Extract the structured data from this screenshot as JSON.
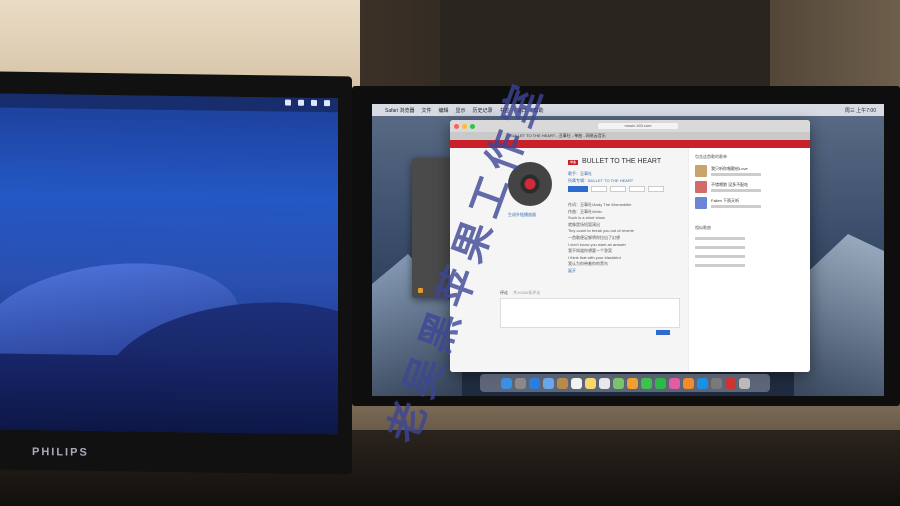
{
  "left_monitor": {
    "brand": "PHILIPS"
  },
  "right_monitor": {
    "menubar": {
      "apple": "",
      "items": [
        "Safari 浏览器",
        "文件",
        "编辑",
        "显示",
        "历史记录",
        "书签",
        "窗口",
        "帮助"
      ],
      "clock": "周三 上午7:00"
    },
    "safari": {
      "url": "music.163.com",
      "tabs": [
        "BULLET TO THE HEART - 丑事社 - 单曲 - 网易云音乐"
      ],
      "song_title": "BULLET TO THE HEART",
      "tag": "单曲",
      "meta": [
        "歌手：丑事社",
        "所属专辑：BULLET TO THE HEART"
      ],
      "buttons": [
        "播放",
        "收藏",
        "分享",
        "下载",
        "评论"
      ],
      "disc_label": "生成外链播放器",
      "lyrics": [
        "作词：丑事社/Andy The Wornedelle",
        "作曲：丑事社/Ieblo",
        "Such is a short show",
        "就像是场短暂演出",
        "Tiny count to break you out of reverie",
        "一首歌便足够将你拉出了幻想",
        "I don't know you want an answer",
        "我不知道你想要一个答案",
        "I think that with your blackbird",
        "我认为你带着你的黑鸟"
      ],
      "expand": "展开",
      "comment_header": "评论",
      "comment_count": "共10000条评论",
      "sidebar_header": "包含这首歌的歌单",
      "sidebar_items": [
        "我只听你唱歌给Love",
        "不错喂狼 没多不配吃",
        "Fallen 下雨天听"
      ],
      "similar_header": "相似歌曲"
    },
    "dock_icons": [
      "finder",
      "launchpad",
      "safari",
      "mail",
      "contacts",
      "calendar",
      "notes",
      "reminders",
      "maps",
      "photos",
      "messages",
      "facetime",
      "itunes",
      "ibooks",
      "app-store",
      "system-preferences",
      "trash"
    ]
  },
  "watermark": "老吴黑苹果工作室"
}
